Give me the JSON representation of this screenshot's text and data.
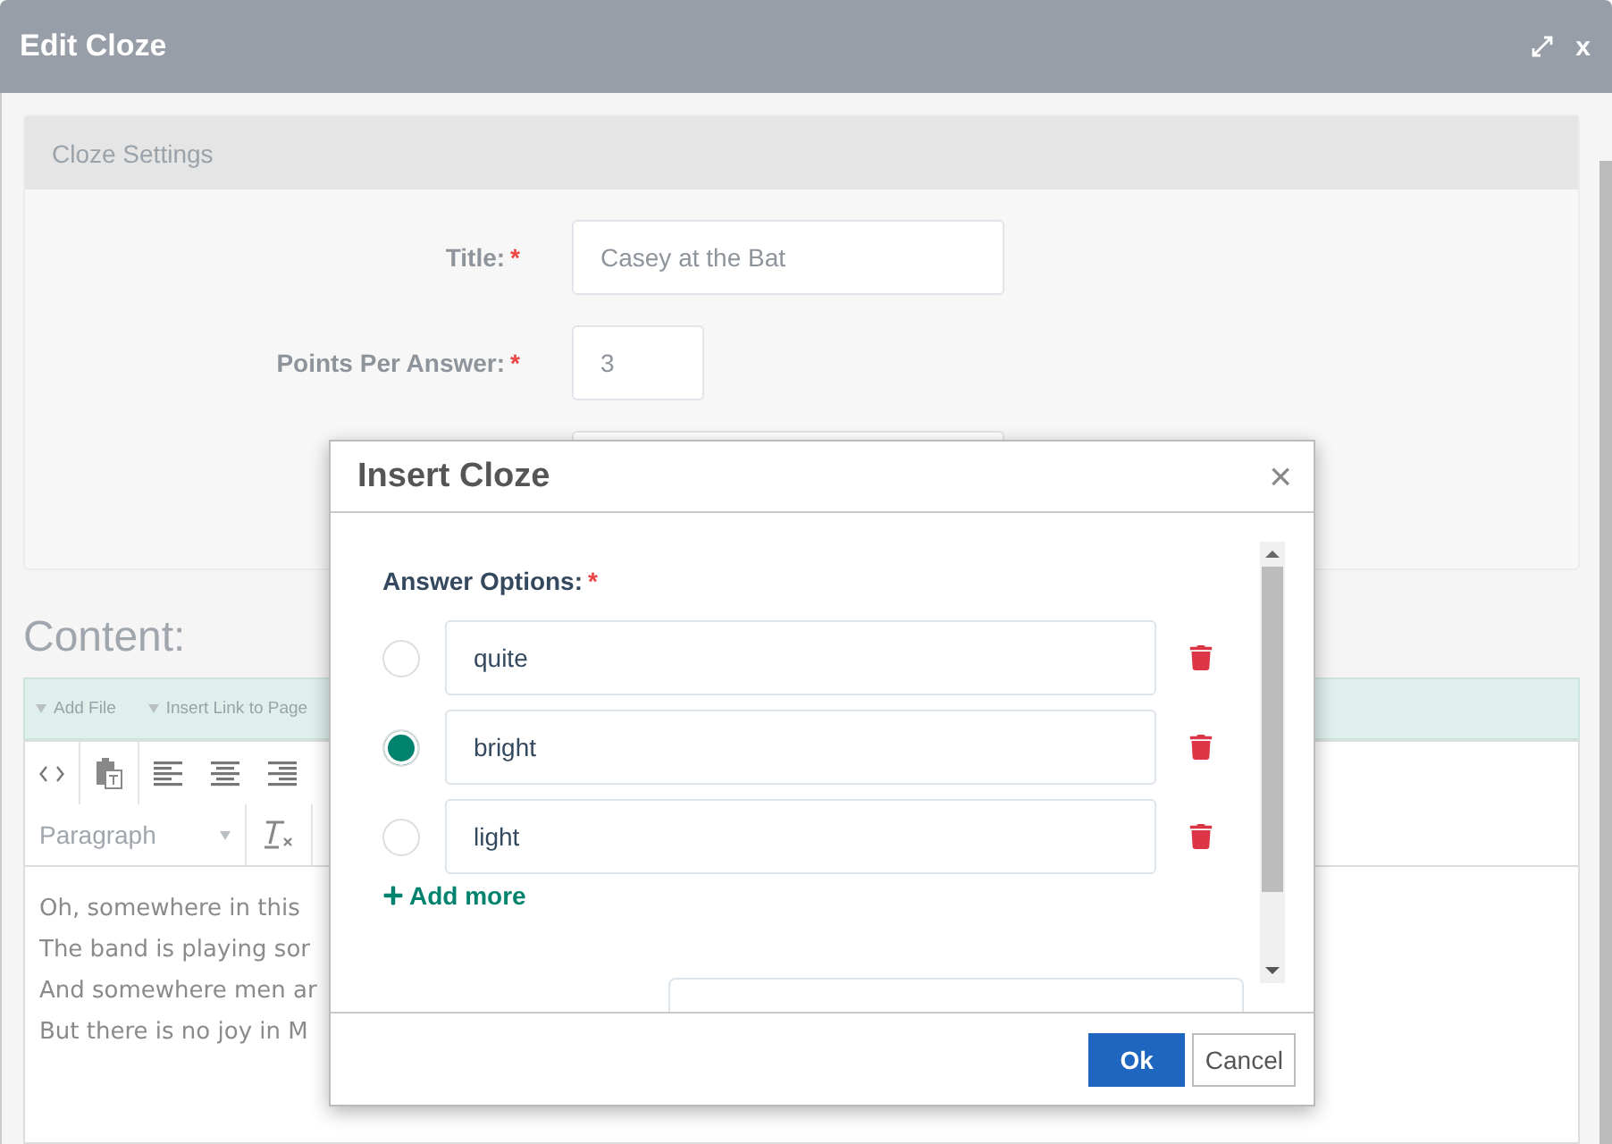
{
  "window": {
    "title": "Edit Cloze",
    "controls": [
      "x"
    ]
  },
  "settings": {
    "header": "Cloze Settings",
    "fields": [
      {
        "label": "Title:",
        "required_mark": "*",
        "value": "Casey at the Bat",
        "kind": "text"
      },
      {
        "label": "Points Per Answer:",
        "required_mark": "*",
        "value": "3",
        "kind": "number"
      }
    ]
  },
  "content": {
    "heading": "Content:",
    "links": [
      "Add File",
      "Insert Link to Page"
    ],
    "format_select": "Paragraph",
    "lines": [
      "Oh, somewhere in this",
      "The band is playing sor",
      "And somewhere men ar",
      "But there is no joy in M"
    ]
  },
  "dialog": {
    "title": "Insert Cloze",
    "close": "×",
    "label": "Answer Options:",
    "required_mark": "*",
    "options": [
      {
        "value": "quite",
        "selected": false
      },
      {
        "value": "bright",
        "selected": true
      },
      {
        "value": "light",
        "selected": false
      }
    ],
    "add_more": "Add more",
    "buttons": [
      {
        "label": "Ok",
        "kind": "primary"
      },
      {
        "label": "Cancel",
        "kind": "secondary"
      }
    ]
  }
}
